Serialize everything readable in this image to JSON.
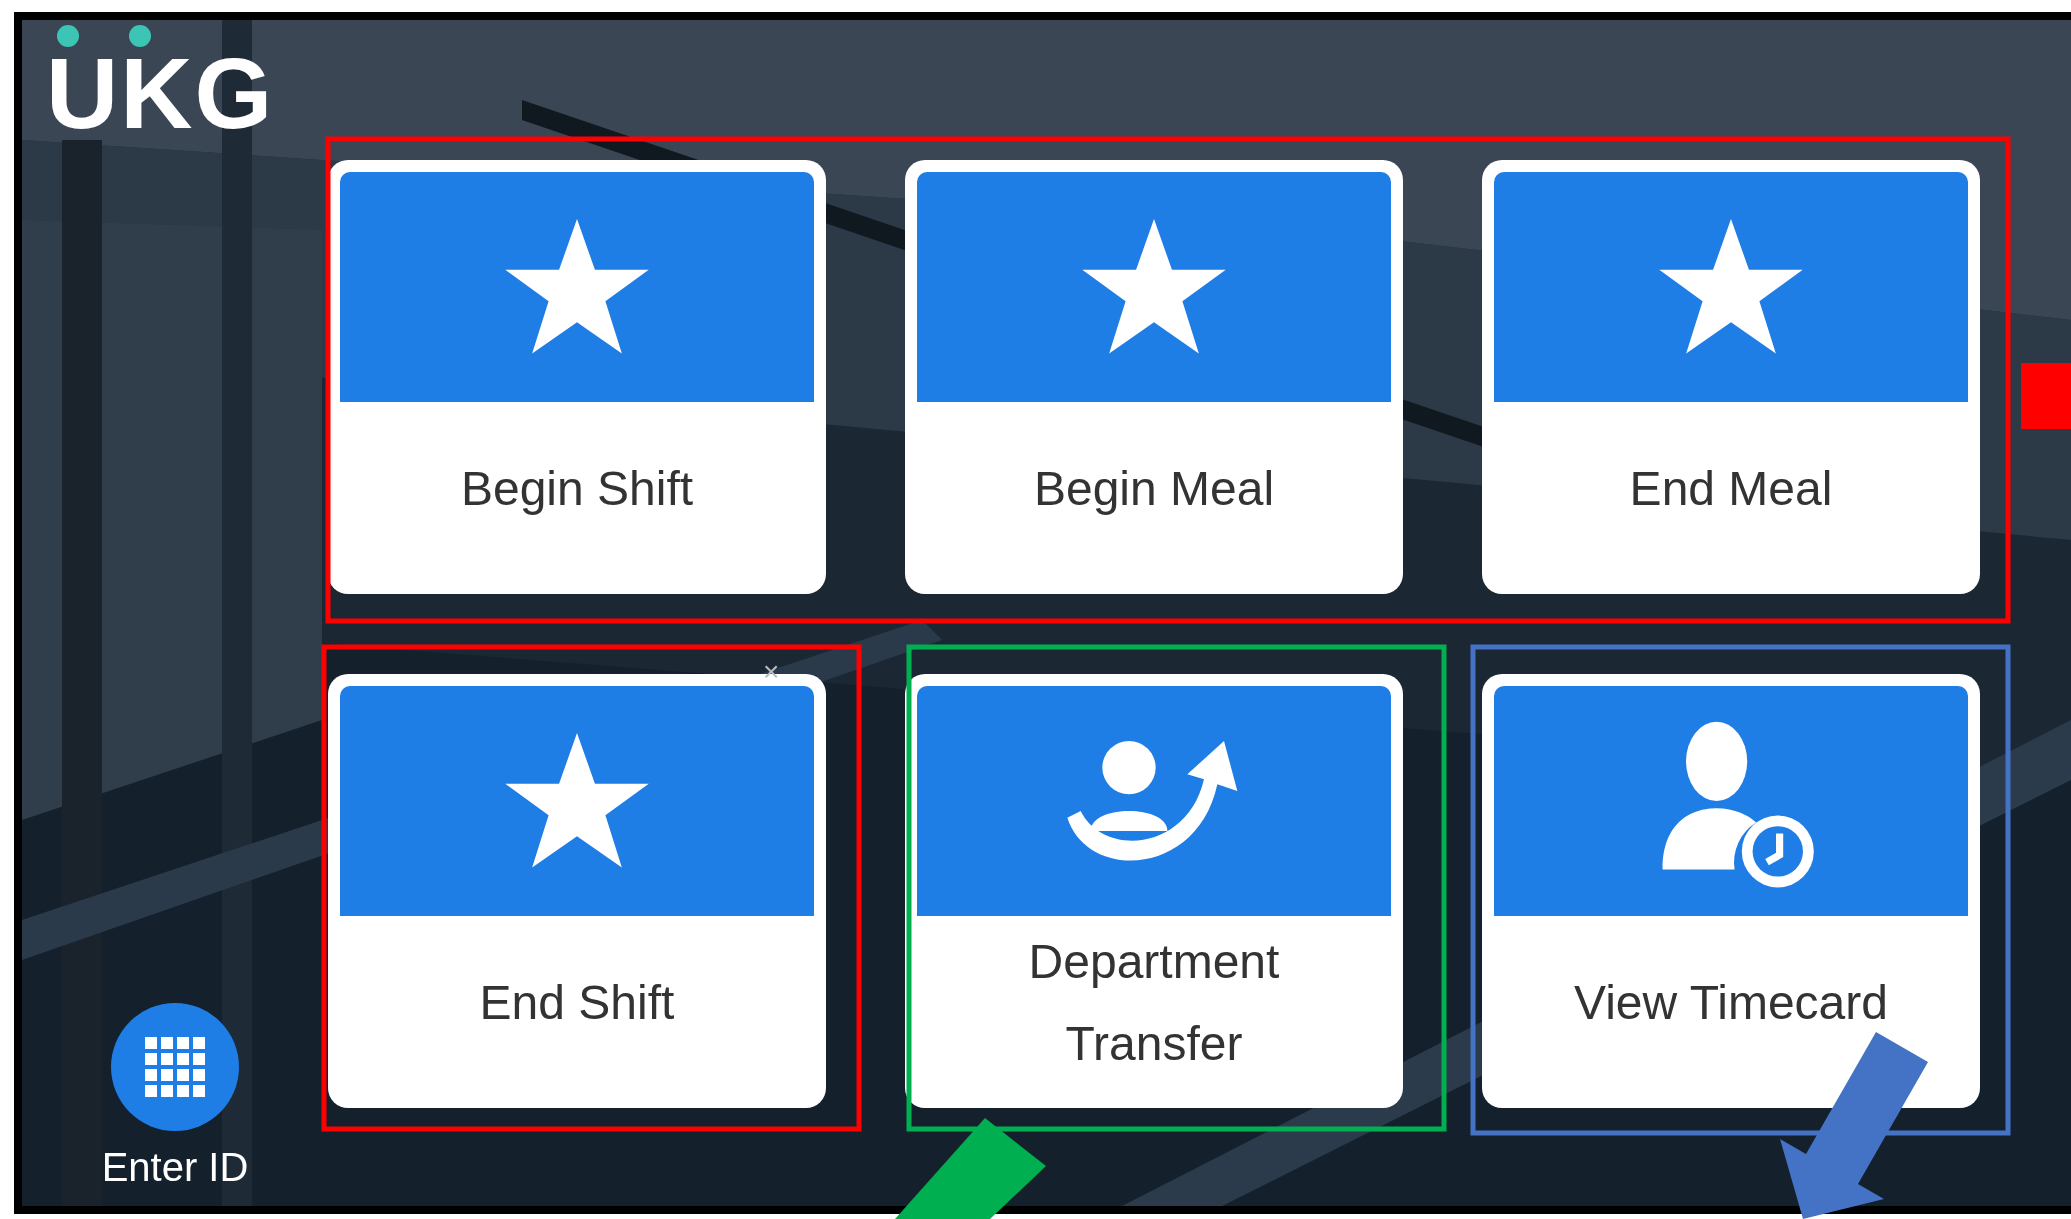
{
  "logo": {
    "text": "UKG"
  },
  "tiles": [
    {
      "label": "Begin Shift",
      "kind": "star"
    },
    {
      "label": "Begin Meal",
      "kind": "star"
    },
    {
      "label": "End Meal",
      "kind": "star"
    },
    {
      "label": "End Shift",
      "kind": "star"
    },
    {
      "label": "Department Transfer",
      "kind": "transfer"
    },
    {
      "label": "View Timecard",
      "kind": "timecard"
    }
  ],
  "dismiss_mark": "×",
  "enter_id": {
    "label": "Enter ID"
  },
  "annotations": [
    {
      "kind": "frame",
      "color": "#ff0000"
    },
    {
      "kind": "frame",
      "color": "#ff0000"
    },
    {
      "kind": "frame",
      "color": "#00b050"
    },
    {
      "kind": "frame",
      "color": "#4472c4"
    },
    {
      "kind": "block",
      "color": "#ff0000"
    },
    {
      "kind": "arrow",
      "color": "#00b050"
    },
    {
      "kind": "arrow",
      "color": "#4472c4"
    }
  ]
}
